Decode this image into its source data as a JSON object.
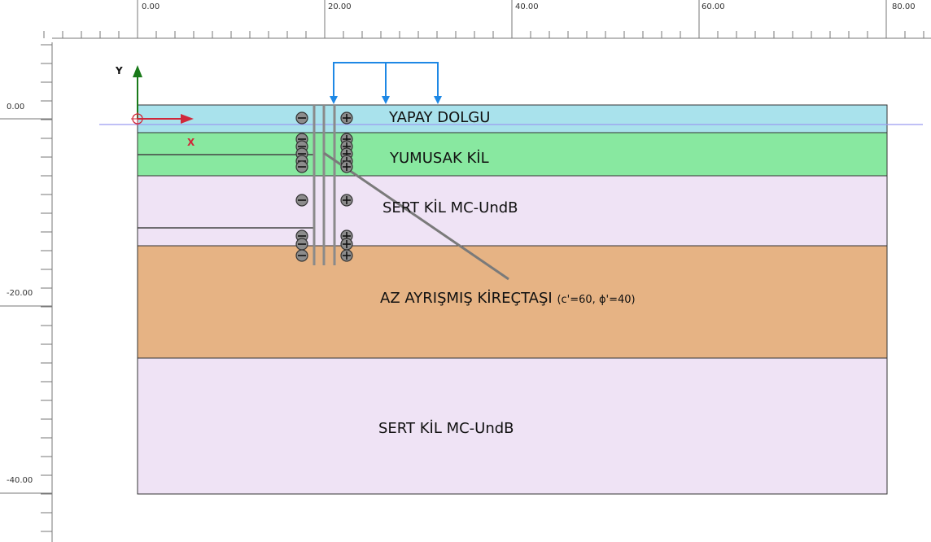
{
  "horizontal_ruler": {
    "labels": [
      "0.00",
      "20.00",
      "40.00",
      "60.00",
      "80.00"
    ]
  },
  "vertical_ruler": {
    "labels": [
      "0.00",
      "-20.00",
      "-40.00"
    ]
  },
  "axes": {
    "y_label": "Y",
    "x_label": "X"
  },
  "layers": [
    {
      "name": "YAPAY DOLGU",
      "color": "#a9e2ec"
    },
    {
      "name": "YUMUSAK KİL",
      "color": "#88e8a0"
    },
    {
      "name": "SERT KİL MC-UndB",
      "color": "#efe3f5"
    },
    {
      "name": "AZ AYRIŞMIŞ KİREÇTAŞI",
      "suffix": "(c'=60, ϕ'=40)",
      "color": "#e6b384"
    },
    {
      "name": "SERT KİL MC-UndB",
      "color": "#efe3f5"
    }
  ],
  "colors": {
    "load_arrows": "#1e88e5",
    "axis_y": "#1a7a1a",
    "axis_x": "#d0283a",
    "wall": "#8a8a8a",
    "water_line": "#9a9af0",
    "outline": "#333333"
  },
  "icons": [
    "minus-circle-icon",
    "plus-circle-icon",
    "origin-crosshair-icon"
  ]
}
